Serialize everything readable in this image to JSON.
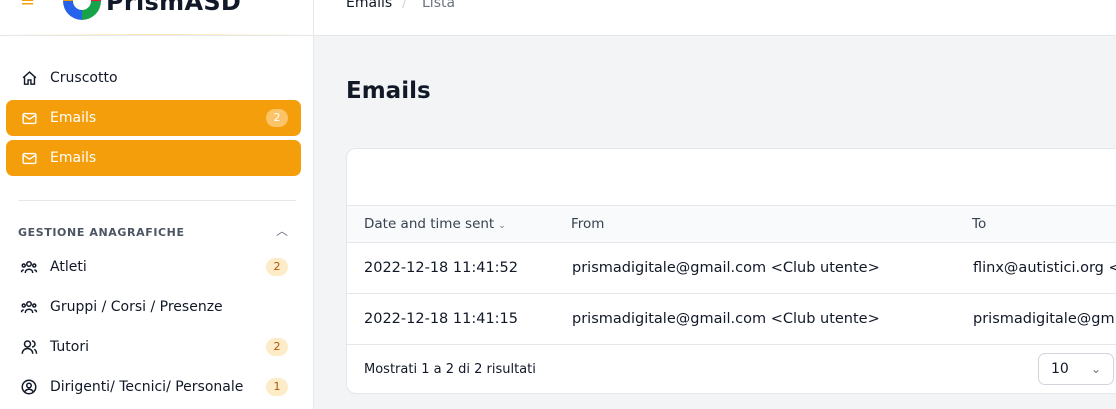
{
  "brand": {
    "name": "PrismASD"
  },
  "breadcrumb": {
    "items": [
      "Emails",
      "Lista"
    ],
    "separator": "/"
  },
  "sidebar": {
    "items": [
      {
        "label": "Cruscotto",
        "icon": "home-icon",
        "active": false
      },
      {
        "label": "Emails",
        "icon": "mail-icon",
        "active": true,
        "badge": "2"
      },
      {
        "label": "Emails",
        "icon": "mail-icon",
        "active": true
      }
    ],
    "section": {
      "title": "GESTIONE ANAGRAFICHE",
      "items": [
        {
          "label": "Atleti",
          "icon": "users-icon",
          "badge": "2"
        },
        {
          "label": "Gruppi / Corsi / Presenze",
          "icon": "users-icon"
        },
        {
          "label": "Tutori",
          "icon": "user-group-icon",
          "badge": "2"
        },
        {
          "label": "Dirigenti/ Tecnici/ Personale",
          "icon": "user-circle-icon",
          "badge": "1"
        }
      ]
    }
  },
  "page": {
    "title": "Emails"
  },
  "table": {
    "columns": [
      "Date and time sent",
      "From",
      "To"
    ],
    "rows": [
      [
        "2022-12-18 11:41:52",
        "prismadigitale@gmail.com <Club utente>",
        "flinx@autistici.org <"
      ],
      [
        "2022-12-18 11:41:15",
        "prismadigitale@gmail.com <Club utente>",
        "prismadigitale@gm"
      ]
    ],
    "summary": "Mostrati 1 a 2 di 2 risultati",
    "per_page": "10"
  },
  "colors": {
    "accent": "#f59e0b",
    "background": "#f3f4f6"
  }
}
